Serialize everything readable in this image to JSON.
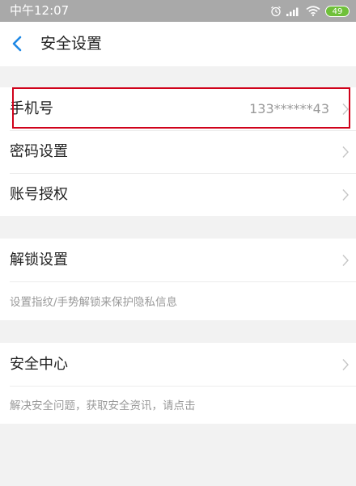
{
  "status_bar": {
    "time": "中午12:07",
    "battery": "49"
  },
  "header": {
    "title": "安全设置"
  },
  "account_section": {
    "phone_label": "手机号",
    "phone_value": "133******43",
    "password_label": "密码设置",
    "authorization_label": "账号授权"
  },
  "unlock_section": {
    "label": "解锁设置",
    "hint": "设置指纹/手势解锁来保护隐私信息"
  },
  "security_center_section": {
    "label": "安全中心",
    "hint": "解决安全问题，获取安全资讯，请点击"
  },
  "colors": {
    "accent": "#1e88e5",
    "highlight": "#d0021b",
    "battery": "#6fc03a"
  },
  "icons": [
    "alarm-icon",
    "signal-icon",
    "wifi-icon",
    "battery-icon",
    "back-arrow-icon",
    "chevron-right-icon"
  ]
}
